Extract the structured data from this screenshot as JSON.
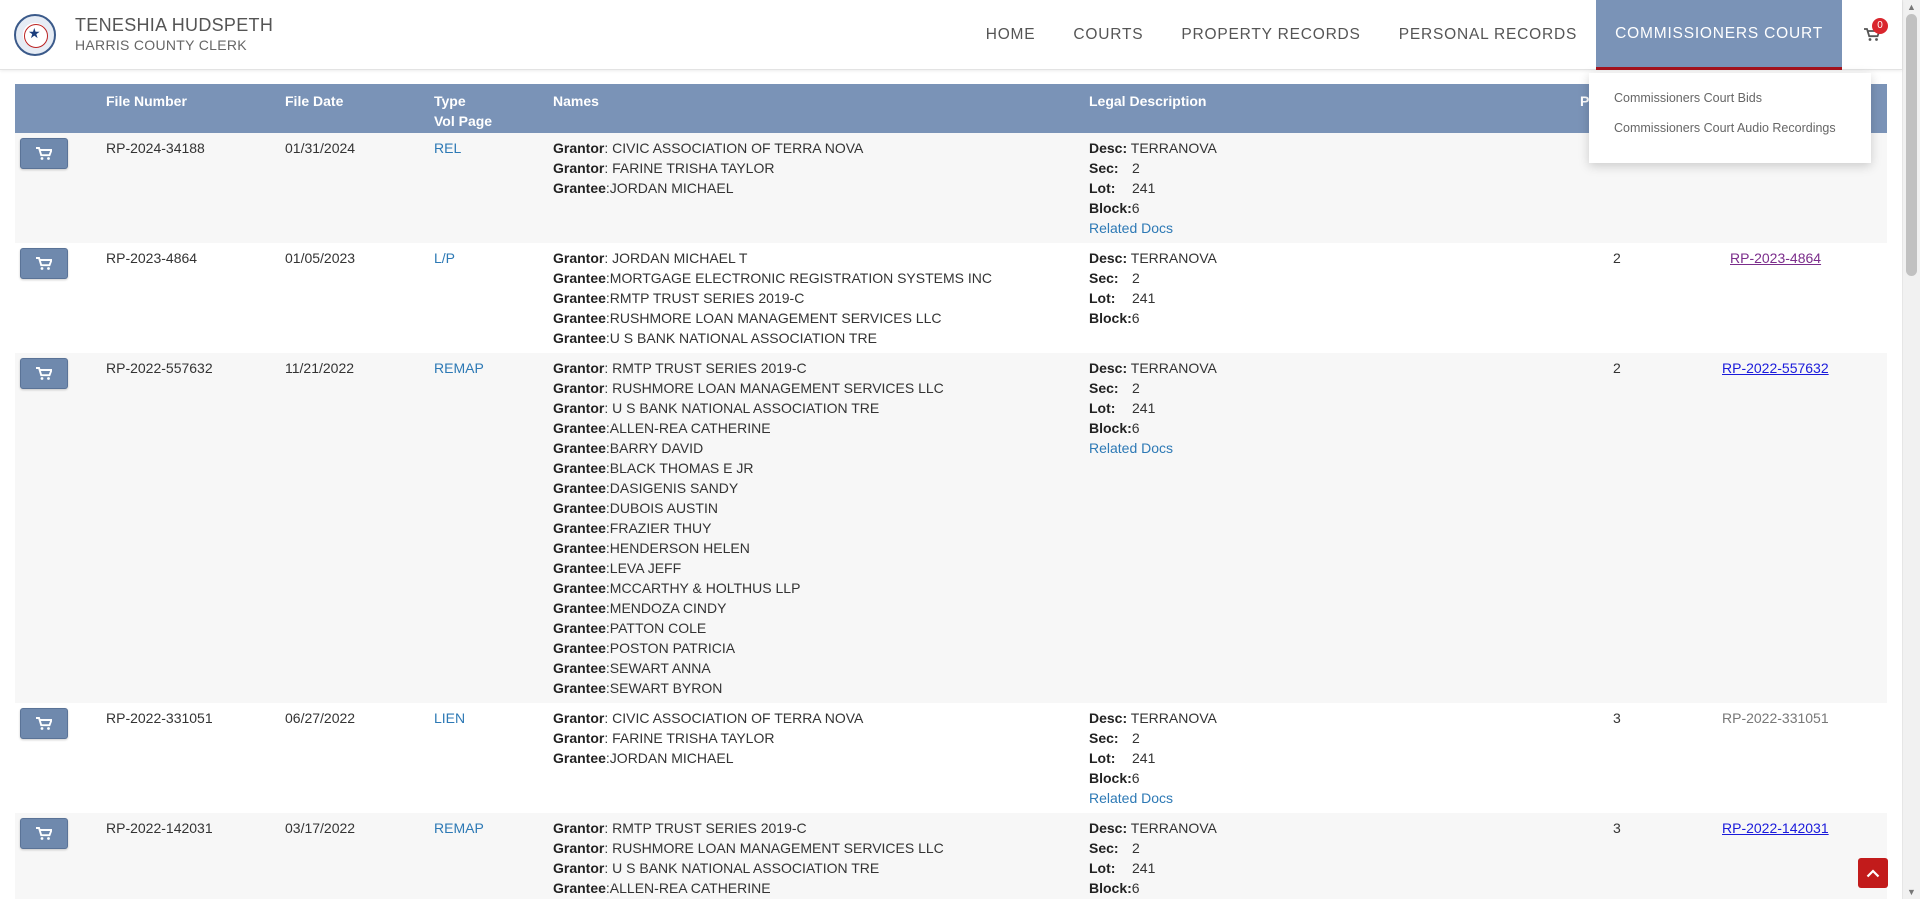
{
  "header": {
    "name": "TENESHIA HUDSPETH",
    "subtitle": "HARRIS COUNTY CLERK",
    "nav": [
      "HOME",
      "COURTS",
      "PROPERTY RECORDS",
      "PERSONAL RECORDS",
      "COMMISSIONERS COURT"
    ],
    "cart_count": "0"
  },
  "dropdown": {
    "items": [
      "Commissioners Court Bids",
      "Commissioners Court Audio Recordings"
    ]
  },
  "table": {
    "headers": {
      "file_number": "File Number",
      "file_date": "File Date",
      "type": "Type",
      "vol_page": "Vol Page",
      "names": "Names",
      "legal": "Legal Description",
      "pages": "P"
    },
    "rows": [
      {
        "file_number": "RP-2024-34188",
        "file_date": "01/31/2024",
        "type": "REL",
        "names": [
          [
            "Grantor",
            ": CIVIC ASSOCIATION OF TERRA NOVA"
          ],
          [
            "Grantor",
            ": FARINE TRISHA TAYLOR"
          ],
          [
            "Grantee",
            ":JORDAN MICHAEL"
          ]
        ],
        "legal": {
          "desc": "TERRANOVA",
          "sec": "2",
          "lot": "241",
          "block": "6",
          "related": "Related Docs"
        },
        "pages": "",
        "doc": "",
        "doc_style": "none"
      },
      {
        "file_number": "RP-2023-4864",
        "file_date": "01/05/2023",
        "type": "L/P",
        "names": [
          [
            "Grantor",
            ": JORDAN MICHAEL T"
          ],
          [
            "Grantee",
            ":MORTGAGE ELECTRONIC REGISTRATION SYSTEMS INC"
          ],
          [
            "Grantee",
            ":RMTP TRUST SERIES 2019-C"
          ],
          [
            "Grantee",
            ":RUSHMORE LOAN MANAGEMENT SERVICES LLC"
          ],
          [
            "Grantee",
            ":U S BANK NATIONAL ASSOCIATION TRE"
          ]
        ],
        "legal": {
          "desc": "TERRANOVA",
          "sec": "2",
          "lot": "241",
          "block": "6",
          "related": ""
        },
        "pages": "2",
        "doc": "RP-2023-4864",
        "doc_style": "visited"
      },
      {
        "file_number": "RP-2022-557632",
        "file_date": "11/21/2022",
        "type": "REMAP",
        "names": [
          [
            "Grantor",
            ": RMTP TRUST SERIES 2019-C"
          ],
          [
            "Grantor",
            ": RUSHMORE LOAN MANAGEMENT SERVICES LLC"
          ],
          [
            "Grantor",
            ": U S BANK NATIONAL ASSOCIATION TRE"
          ],
          [
            "Grantee",
            ":ALLEN-REA CATHERINE"
          ],
          [
            "Grantee",
            ":BARRY DAVID"
          ],
          [
            "Grantee",
            ":BLACK THOMAS E JR"
          ],
          [
            "Grantee",
            ":DASIGENIS SANDY"
          ],
          [
            "Grantee",
            ":DUBOIS AUSTIN"
          ],
          [
            "Grantee",
            ":FRAZIER THUY"
          ],
          [
            "Grantee",
            ":HENDERSON HELEN"
          ],
          [
            "Grantee",
            ":LEVA JEFF"
          ],
          [
            "Grantee",
            ":MCCARTHY & HOLTHUS LLP"
          ],
          [
            "Grantee",
            ":MENDOZA CINDY"
          ],
          [
            "Grantee",
            ":PATTON COLE"
          ],
          [
            "Grantee",
            ":POSTON PATRICIA"
          ],
          [
            "Grantee",
            ":SEWART ANNA"
          ],
          [
            "Grantee",
            ":SEWART BYRON"
          ]
        ],
        "legal": {
          "desc": "TERRANOVA",
          "sec": "2",
          "lot": "241",
          "block": "6",
          "related": "Related Docs"
        },
        "pages": "2",
        "doc": "RP-2022-557632",
        "doc_style": "blue"
      },
      {
        "file_number": "RP-2022-331051",
        "file_date": "06/27/2022",
        "type": "LIEN",
        "names": [
          [
            "Grantor",
            ": CIVIC ASSOCIATION OF TERRA NOVA"
          ],
          [
            "Grantor",
            ": FARINE TRISHA TAYLOR"
          ],
          [
            "Grantee",
            ":JORDAN MICHAEL"
          ]
        ],
        "legal": {
          "desc": "TERRANOVA",
          "sec": "2",
          "lot": "241",
          "block": "6",
          "related": "Related Docs"
        },
        "pages": "3",
        "doc": "RP-2022-331051",
        "doc_style": "plain"
      },
      {
        "file_number": "RP-2022-142031",
        "file_date": "03/17/2022",
        "type": "REMAP",
        "names": [
          [
            "Grantor",
            ": RMTP TRUST SERIES 2019-C"
          ],
          [
            "Grantor",
            ": RUSHMORE LOAN MANAGEMENT SERVICES LLC"
          ],
          [
            "Grantor",
            ": U S BANK NATIONAL ASSOCIATION TRE"
          ],
          [
            "Grantee",
            ":ALLEN-REA CATHERINE"
          ]
        ],
        "legal": {
          "desc": "TERRANOVA",
          "sec": "2",
          "lot": "241",
          "block": "6",
          "related": ""
        },
        "pages": "3",
        "doc": "RP-2022-142031",
        "doc_style": "blue"
      }
    ]
  },
  "colors": {
    "header_bg": "#7a93b7",
    "active_underline": "#a5131d",
    "link": "#2d79b5",
    "badge": "#d9262e"
  },
  "icons": [
    "county-seal-icon",
    "cart-icon",
    "chevron-up-icon"
  ]
}
